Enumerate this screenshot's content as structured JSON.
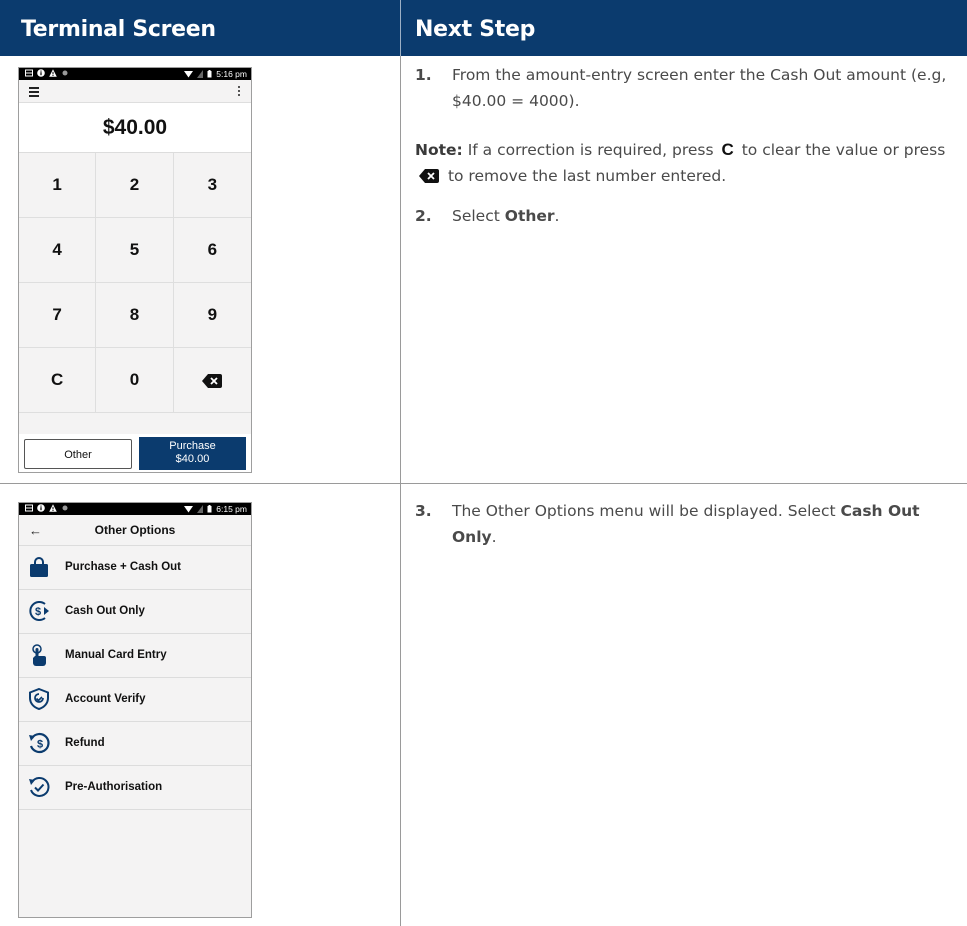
{
  "header": {
    "left": "Terminal Screen",
    "right": "Next Step"
  },
  "screen1": {
    "status_time": "5:16 pm",
    "amount": "$40.00",
    "keys": [
      "1",
      "2",
      "3",
      "4",
      "5",
      "6",
      "7",
      "8",
      "9",
      "C",
      "0",
      "⌫"
    ],
    "other_label": "Other",
    "purchase_label": "Purchase",
    "purchase_amount": "$40.00"
  },
  "screen2": {
    "status_time": "6:15 pm",
    "title": "Other Options",
    "options": [
      {
        "label": "Purchase + Cash Out",
        "icon": "shopping-bag-icon"
      },
      {
        "label": "Cash Out Only",
        "icon": "cash-out-icon"
      },
      {
        "label": "Manual Card Entry",
        "icon": "touch-hand-icon"
      },
      {
        "label": "Account Verify",
        "icon": "verify-shield-icon"
      },
      {
        "label": "Refund",
        "icon": "refund-icon"
      },
      {
        "label": "Pre-Authorisation",
        "icon": "pre-auth-icon"
      }
    ]
  },
  "steps": {
    "s1_num": "1.",
    "s1_text": "From the amount-entry screen enter the Cash Out amount (e.g, $40.00 = 4000).",
    "note_label": "Note:",
    "note_text_a": "If a correction is required, press",
    "note_text_b": "to clear the value or press",
    "note_text_c": "to remove the last number entered.",
    "note_c": "C",
    "s2_num": "2.",
    "s2_text": "Select",
    "s2_bold": "Other",
    "s3_num": "3.",
    "s3_text": "The Other Options menu will be displayed. Select",
    "s3_bold": "Cash Out Only"
  },
  "colors": {
    "brand_navy": "#0b3b6e"
  }
}
